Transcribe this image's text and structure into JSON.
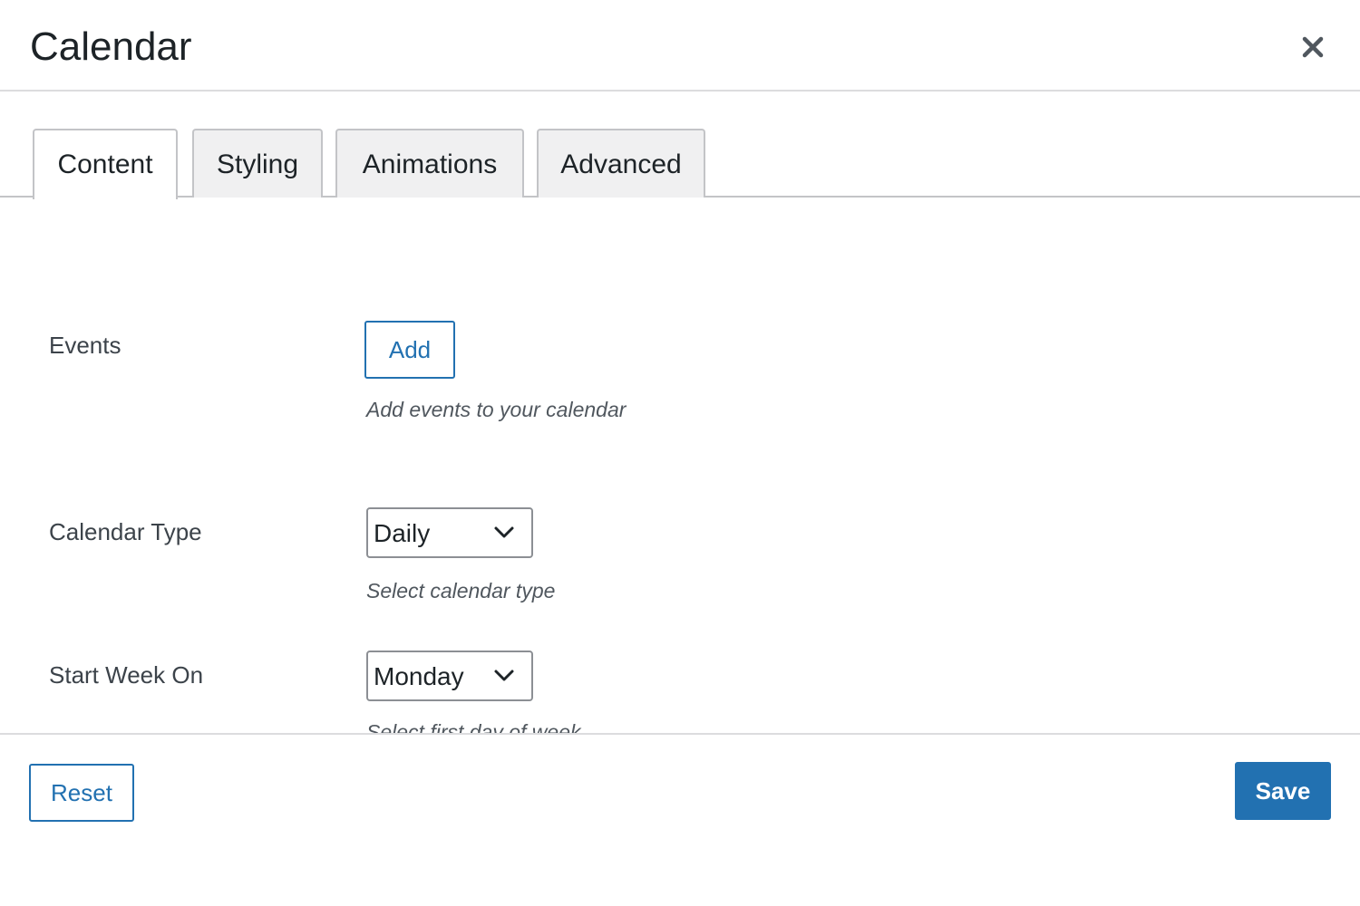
{
  "modal": {
    "title": "Calendar",
    "close_icon": "close-icon"
  },
  "tabs": [
    {
      "label": "Content",
      "active": true
    },
    {
      "label": "Styling",
      "active": false
    },
    {
      "label": "Animations",
      "active": false
    },
    {
      "label": "Advanced",
      "active": false
    }
  ],
  "fields": {
    "events": {
      "label": "Events",
      "button_label": "Add",
      "help": "Add events to your calendar"
    },
    "calendar_type": {
      "label": "Calendar Type",
      "value": "Daily",
      "help": "Select calendar type",
      "icon": "chevron-down-icon"
    },
    "start_week_on": {
      "label": "Start Week On",
      "value": "Monday",
      "help": "Select first day of week",
      "icon": "chevron-down-icon"
    }
  },
  "footer": {
    "reset_label": "Reset",
    "save_label": "Save"
  },
  "colors": {
    "accent": "#2271b1",
    "text": "#1d2327",
    "border": "#c3c4c7"
  }
}
